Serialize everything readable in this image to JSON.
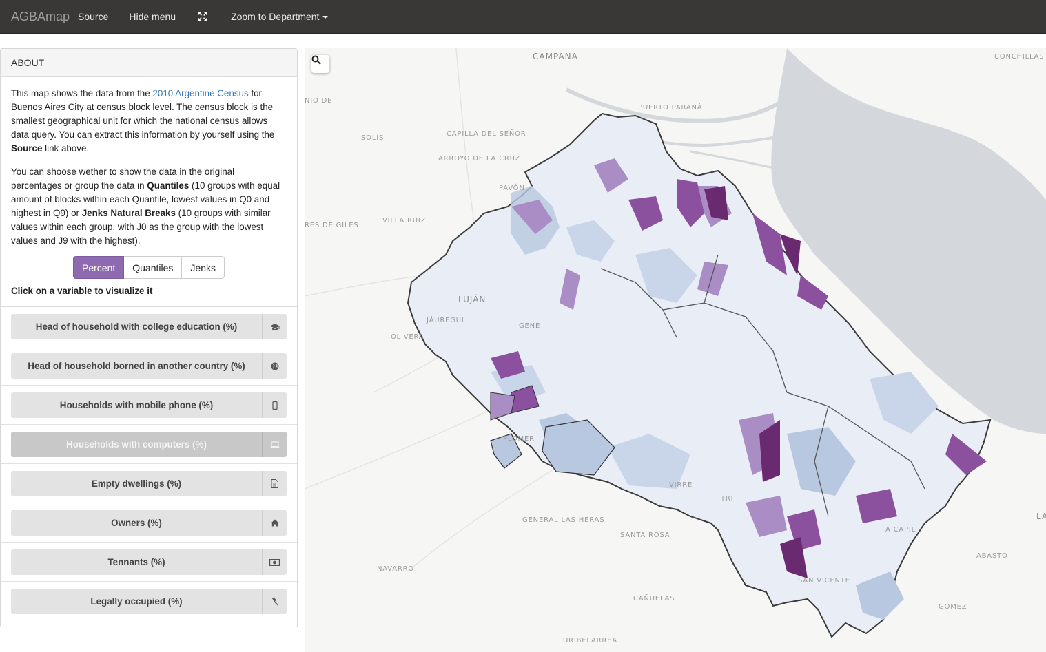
{
  "navbar": {
    "brand": "AGBAmap",
    "source": "Source",
    "hide_menu": "Hide menu",
    "zoom": "Zoom to Department"
  },
  "about": {
    "heading": "ABOUT",
    "p1_pre": "This map shows the data from the ",
    "p1_link": "2010 Argentine Census",
    "p1_mid": " for Buenos Aires City at census block level. The census block is the smallest geographical unit for which the national census allows data query. You can extract this information by yourself using the ",
    "p1_bold": "Source",
    "p1_post": " link above.",
    "p2_a": "You can shoose wether to show the data in the original percentages or group the data in ",
    "p2_b": "Quantiles",
    "p2_c": " (10 groups with equal amount of blocks within each Quantile, lowest values in Q0 and highest in Q9) or ",
    "p2_d": "Jenks Natural Breaks",
    "p2_e": " (10 groups with similar values within each group, with J0 as the group with the lowest values and J9 with the highest).",
    "modes": [
      "Percent",
      "Quantiles",
      "Jenks"
    ],
    "active_mode": "Percent",
    "click_hint": "Click on a variable to visualize it"
  },
  "variables": [
    {
      "label": "Head of household with college education (%)",
      "icon": "graduation-cap-icon"
    },
    {
      "label": "Head of household borned in another country (%)",
      "icon": "globe-icon"
    },
    {
      "label": "Households with mobile phone (%)",
      "icon": "mobile-phone-icon"
    },
    {
      "label": "Households with computers (%)",
      "icon": "laptop-icon",
      "selected": true
    },
    {
      "label": "Empty dwellings (%)",
      "icon": "document-icon"
    },
    {
      "label": "Owners (%)",
      "icon": "home-icon"
    },
    {
      "label": "Tennants (%)",
      "icon": "money-icon"
    },
    {
      "label": "Legally occupied (%)",
      "icon": "gavel-icon"
    }
  ],
  "map": {
    "places": [
      "CAMPANA",
      "CONCHILLAS",
      "NIO DE",
      "PUERTO PARANÁ",
      "SOLÍS",
      "CAPILLA DEL SEÑOR",
      "ARROYO DE LA CRUZ",
      "PAVÓN",
      "VILLA RUIZ",
      "RES DE GILES",
      "LUJÁN",
      "JÁUREGUI",
      "OLIVERA",
      "GENE",
      "PLOMER",
      "GENERAL LAS HERAS",
      "SANTA ROSA",
      "NAVARRO",
      "CAÑUELAS",
      "URIBELARREA",
      "ABASTO",
      "GÓMEZ",
      "LA",
      "TRI",
      "A CAPIL",
      "VIRRE",
      "SAN VICENTE"
    ],
    "colors": {
      "light": "#e9eef6",
      "blue": "#b8c8e0",
      "lavender": "#ab8dc6",
      "purple": "#8b519f",
      "dark": "#6a2a6f",
      "water": "#d4d8dc",
      "land": "#f6f6f4"
    }
  }
}
